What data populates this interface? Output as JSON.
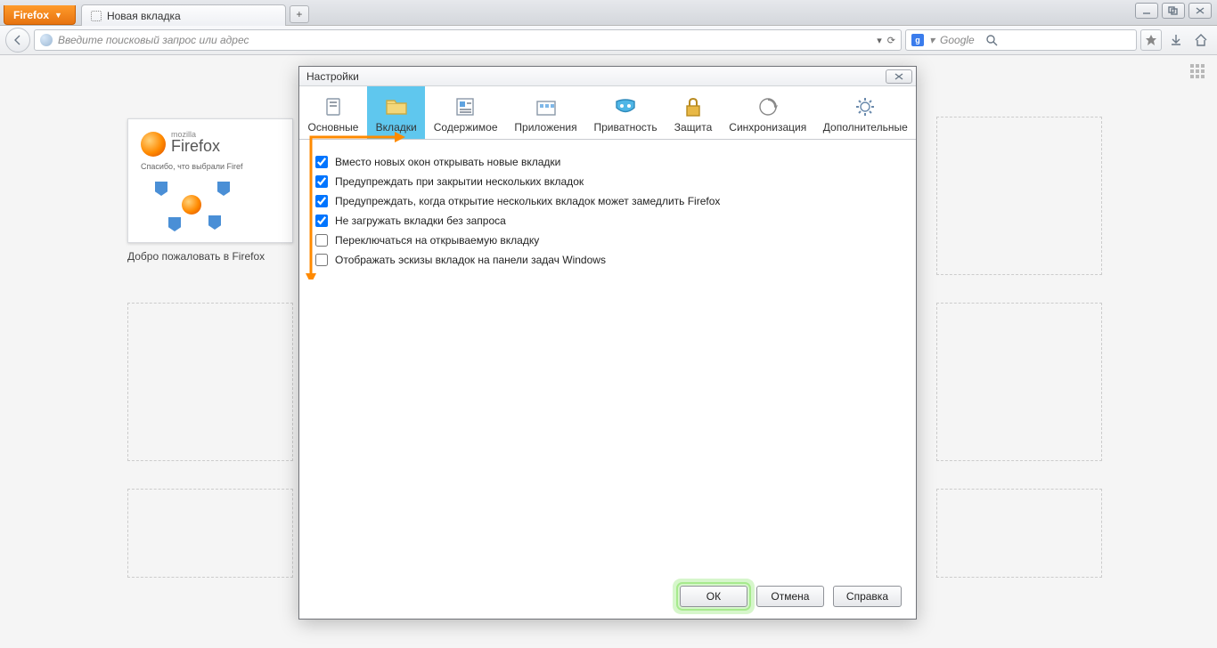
{
  "chrome": {
    "menu_label": "Firefox",
    "tab_title": "Новая вкладка",
    "newtab_plus": "+"
  },
  "nav": {
    "url_placeholder": "Введите поисковый запрос или адрес",
    "search_placeholder": "Google",
    "search_engine_letter": "g",
    "reload_glyph": "⟳"
  },
  "thumb": {
    "caption": "Добро пожаловать в Firefox",
    "heading_text": "Firefox",
    "sub_text": "Спасибо, что выбрали Firef"
  },
  "dialog": {
    "title": "Настройки",
    "tabs": {
      "general": "Основные",
      "tabs": "Вкладки",
      "content": "Содержимое",
      "applications": "Приложения",
      "privacy": "Приватность",
      "security": "Защита",
      "sync": "Синхронизация",
      "advanced": "Дополнительные"
    },
    "options": {
      "open_tabs_instead_windows": {
        "checked": true,
        "label": "Вместо новых окон открывать новые вкладки"
      },
      "warn_close_multiple": {
        "checked": true,
        "label": "Предупреждать при закрытии нескольких вкладок"
      },
      "warn_slow_many_tabs": {
        "checked": true,
        "label": "Предупреждать, когда открытие нескольких вкладок может замедлить Firefox"
      },
      "dont_load_until_selected": {
        "checked": true,
        "label": "Не загружать вкладки без запроса"
      },
      "switch_to_opened_tab": {
        "checked": false,
        "label": "Переключаться на открываемую вкладку"
      },
      "show_taskbar_thumbnails": {
        "checked": false,
        "label": "Отображать эскизы вкладок на панели задач Windows"
      }
    },
    "buttons": {
      "ok": "ОК",
      "cancel": "Отмена",
      "help": "Справка"
    }
  },
  "colors": {
    "accent_tab_bg": "#5fc7ee",
    "ff_orange": "#ff8a00",
    "ok_highlight": "#b4eea0"
  }
}
